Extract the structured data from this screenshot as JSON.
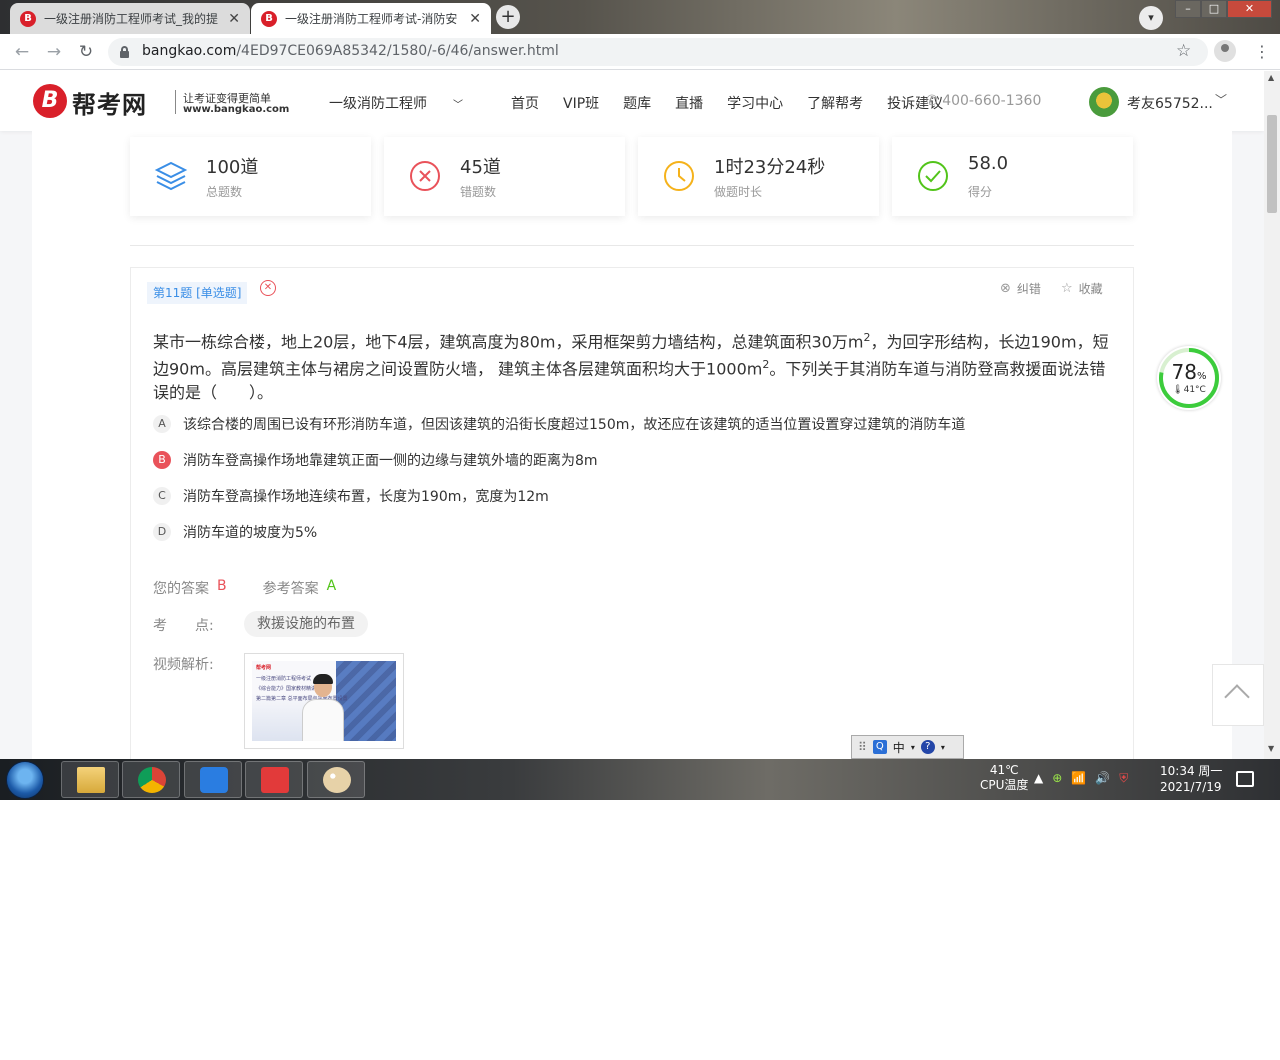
{
  "browser": {
    "tabs": [
      {
        "title": "一级注册消防工程师考试_我的提",
        "close": "✕"
      },
      {
        "title": "一级注册消防工程师考试-消防安",
        "close": "✕"
      }
    ],
    "new_tab": "+",
    "url_host": "bangkao.com",
    "url_path": "/4ED97CE069A85342/1580/-6/46/answer.html"
  },
  "site": {
    "logo_text": "帮考网",
    "slogan": "让考证变得更简单",
    "domain": "www.bangkao.com",
    "nav": [
      "一级消防工程师",
      "首页",
      "VIP班",
      "题库",
      "直播",
      "学习中心",
      "了解帮考",
      "投诉建议"
    ],
    "phone": "400-660-1360",
    "username": "考友65752..."
  },
  "stats": [
    {
      "value": "100道",
      "label": "总题数",
      "icon": "layers-icon",
      "color": "#3a8ee6"
    },
    {
      "value": "45道",
      "label": "错题数",
      "icon": "x-circle-icon",
      "color": "#e9525a"
    },
    {
      "value": "1时23分24秒",
      "label": "做题时长",
      "icon": "clock-icon",
      "color": "#f5b21b"
    },
    {
      "value": "58.0",
      "label": "得分",
      "icon": "check-circle-icon",
      "color": "#52c41a"
    }
  ],
  "question": {
    "tag": "第11题 [单选题]",
    "correct_tool": "纠错",
    "favorite_tool": "收藏",
    "stem_part1": "某市一栋综合楼，地上20层，地下4层，建筑高度为80m，采用框架剪力墙结构，总建筑面积30万m",
    "stem_sup1": "2",
    "stem_part2": "，为回字形结构，长边190m，短边90m。高层建筑主体与裙房之间设置防火墙， 建筑主体各层建筑面积均大于1000m",
    "stem_sup2": "2",
    "stem_part3": "。下列关于其消防车道与消防登高救援面说法错误的是（　　）。",
    "options": [
      {
        "letter": "A",
        "text": "该综合楼的周围已设有环形消防车道，但因该建筑的沿街长度超过150m，故还应在该建筑的适当位置设置穿过建筑的消防车道",
        "selected": false
      },
      {
        "letter": "B",
        "text": "消防车登高操作场地靠建筑正面一侧的边缘与建筑外墙的距离为8m",
        "selected": true
      },
      {
        "letter": "C",
        "text": "消防车登高操作场地连续布置，长度为190m，宽度为12m",
        "selected": false
      },
      {
        "letter": "D",
        "text": "消防车道的坡度为5%",
        "selected": false
      }
    ],
    "your_answer_label": "您的答案",
    "your_answer": "B",
    "ref_answer_label": "参考答案",
    "ref_answer": "A",
    "kp_label": "考　　点:",
    "kp_value": "救援设施的布置",
    "video_label": "视频解析:",
    "video_brand": "帮考网",
    "video_lines": [
      "一级注册消防工程师考试",
      "《综合能力》国家教材精讲",
      "第二篇第二章 总平面布局与平面布置设置"
    ]
  },
  "cpu_widget": {
    "percent": "78",
    "percent_unit": "%",
    "percent_value": 78,
    "temp": "41°C"
  },
  "ime": {
    "q": "Q",
    "mode": "中",
    "help": "?"
  },
  "taskbar": {
    "cpu_temp": "41℃",
    "cpu_label": "CPU温度",
    "time": "10:34 周一",
    "date": "2021/7/19"
  }
}
